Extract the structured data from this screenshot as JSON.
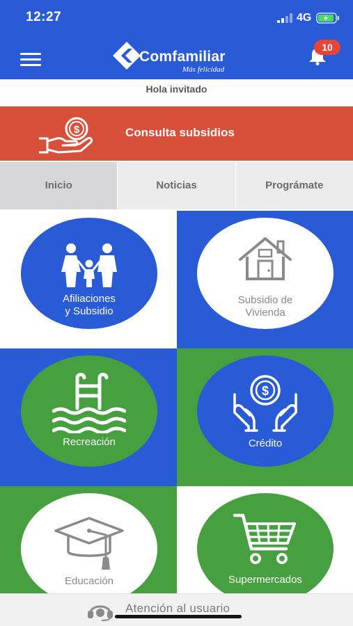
{
  "status_bar": {
    "time": "12:27",
    "network": "4G"
  },
  "header": {
    "brand_name": "Comfamiliar",
    "slogan": "Más felicidad",
    "notification_count": "10"
  },
  "greeting": "Hola invitado",
  "subsidy_banner": {
    "label": "Consulta subsidios"
  },
  "tabs": [
    {
      "label": "Inicio",
      "active": true
    },
    {
      "label": "Noticias",
      "active": false
    },
    {
      "label": "Prográmate",
      "active": false
    }
  ],
  "tiles": [
    {
      "label_line1": "Afiliaciones",
      "label_line2": "y Subsidio",
      "icon": "family-icon"
    },
    {
      "label_line1": "Subsidio de",
      "label_line2": "Vivienda",
      "icon": "house-icon"
    },
    {
      "label_line1": "Recreación",
      "icon": "pool-ladder-icon"
    },
    {
      "label_line1": "Crédito",
      "icon": "money-hands-icon"
    },
    {
      "label_line1": "Educación",
      "icon": "graduation-cap-icon"
    },
    {
      "label_line1": "Supermercados",
      "icon": "shopping-cart-icon"
    }
  ],
  "footer": {
    "label": "Atención al usuario",
    "icon": "headset-icon"
  },
  "colors": {
    "header_blue": "#2a5bd7",
    "banner_red": "#d8503a",
    "tile_blue": "#2a5bd7",
    "tile_green": "#47a03f",
    "badge_red": "#e8443a"
  }
}
